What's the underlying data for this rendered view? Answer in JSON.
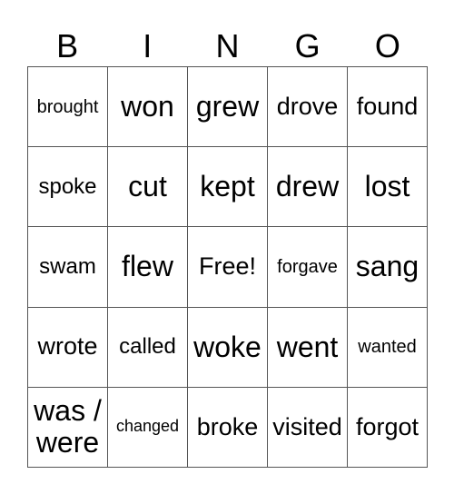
{
  "header": [
    "B",
    "I",
    "N",
    "G",
    "O"
  ],
  "cells": [
    [
      "brought",
      "won",
      "grew",
      "drove",
      "found"
    ],
    [
      "spoke",
      "cut",
      "kept",
      "drew",
      "lost"
    ],
    [
      "swam",
      "flew",
      "Free!",
      "forgave",
      "sang"
    ],
    [
      "wrote",
      "called",
      "woke",
      "went",
      "wanted"
    ],
    [
      "was / were",
      "changed",
      "broke",
      "visited",
      "forgot"
    ]
  ]
}
